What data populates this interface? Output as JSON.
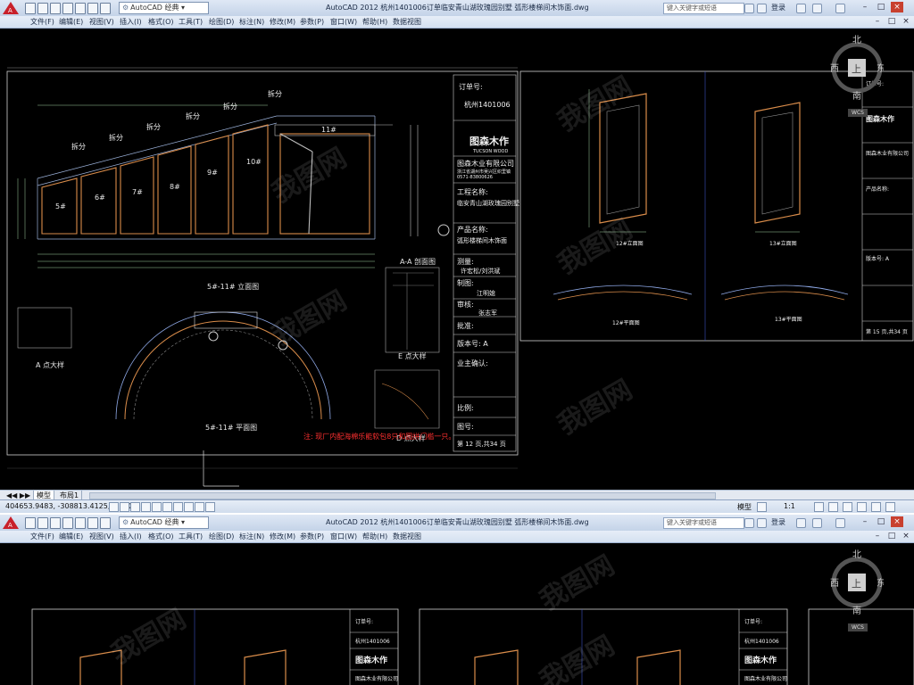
{
  "app": {
    "title": "AutoCAD 2012   杭州1401006订单临安青山湖玫瑰园别墅 弧形楼梯间木饰面.dwg",
    "title2": "AutoCAD 2012   杭州1401006订单临安青山湖玫瑰园别墅 弧形楼梯间木饰面.dwg",
    "workspace": "AutoCAD 经典",
    "search_placeholder": "键入关键字或短语",
    "login": "登录"
  },
  "menu": [
    "文件(F)",
    "编辑(E)",
    "视图(V)",
    "插入(I)",
    "格式(O)",
    "工具(T)",
    "绘图(D)",
    "标注(N)",
    "修改(M)",
    "参数(P)",
    "窗口(W)",
    "帮助(H)",
    "数据视图"
  ],
  "navcube": {
    "north": "北",
    "south": "南",
    "east": "东",
    "west": "西",
    "top": "上",
    "wcs": "WCS"
  },
  "tabs": [
    "模型",
    "布局1"
  ],
  "status": {
    "coords": "404653.9483, -308813.4125, 0.0000",
    "model": "模型",
    "scale": "1:1"
  },
  "watermark": "我图网",
  "drawing": {
    "order_label": "订单号:",
    "order_no": "杭州1401006",
    "brand": "图森木作",
    "brand_en": "TUCSON WOOD",
    "company": "图森木业有限公司",
    "company_addr": "浙江省湖州市吴兴区织里镇",
    "company_tel": "0571-83800626",
    "project_label": "工程名称:",
    "project_name": "临安青山湖玫瑰园别墅",
    "product_label": "产品名称:",
    "product_name": "弧形楼梯间木饰面",
    "survey_label": "测量:",
    "survey_name": "许宏松/刘洪斌",
    "drafter_label": "制图:",
    "drafter_name": "江明媳",
    "review_label": "审核:",
    "review_name": "张志军",
    "approve_label": "批准:",
    "version_label": "版本号: A",
    "owner_label": "业主确认:",
    "scale_label": "比例:",
    "drawing_no_label": "图号:",
    "page_label": "第 12 页,共34 页",
    "page2_label": "第 15 页,共34 页",
    "elev_title": "5#-11# 立面图",
    "plan_title": "5#-11# 平面图",
    "section_title": "A-A 剖面图",
    "detail_a": "A 点大样",
    "detail_d": "D 点大样",
    "detail_e": "E 点大样",
    "note": "注: 现厂内配海棉乐能软包8只和圆拼门槛一只。",
    "split_label": "拆分",
    "elev12": "12#立面图",
    "elev13": "13#立面图",
    "plan12": "12#平面图",
    "plan13": "13#平面图",
    "doors": [
      "5#",
      "6#",
      "7#",
      "8#",
      "9#",
      "10#",
      "11#"
    ]
  }
}
